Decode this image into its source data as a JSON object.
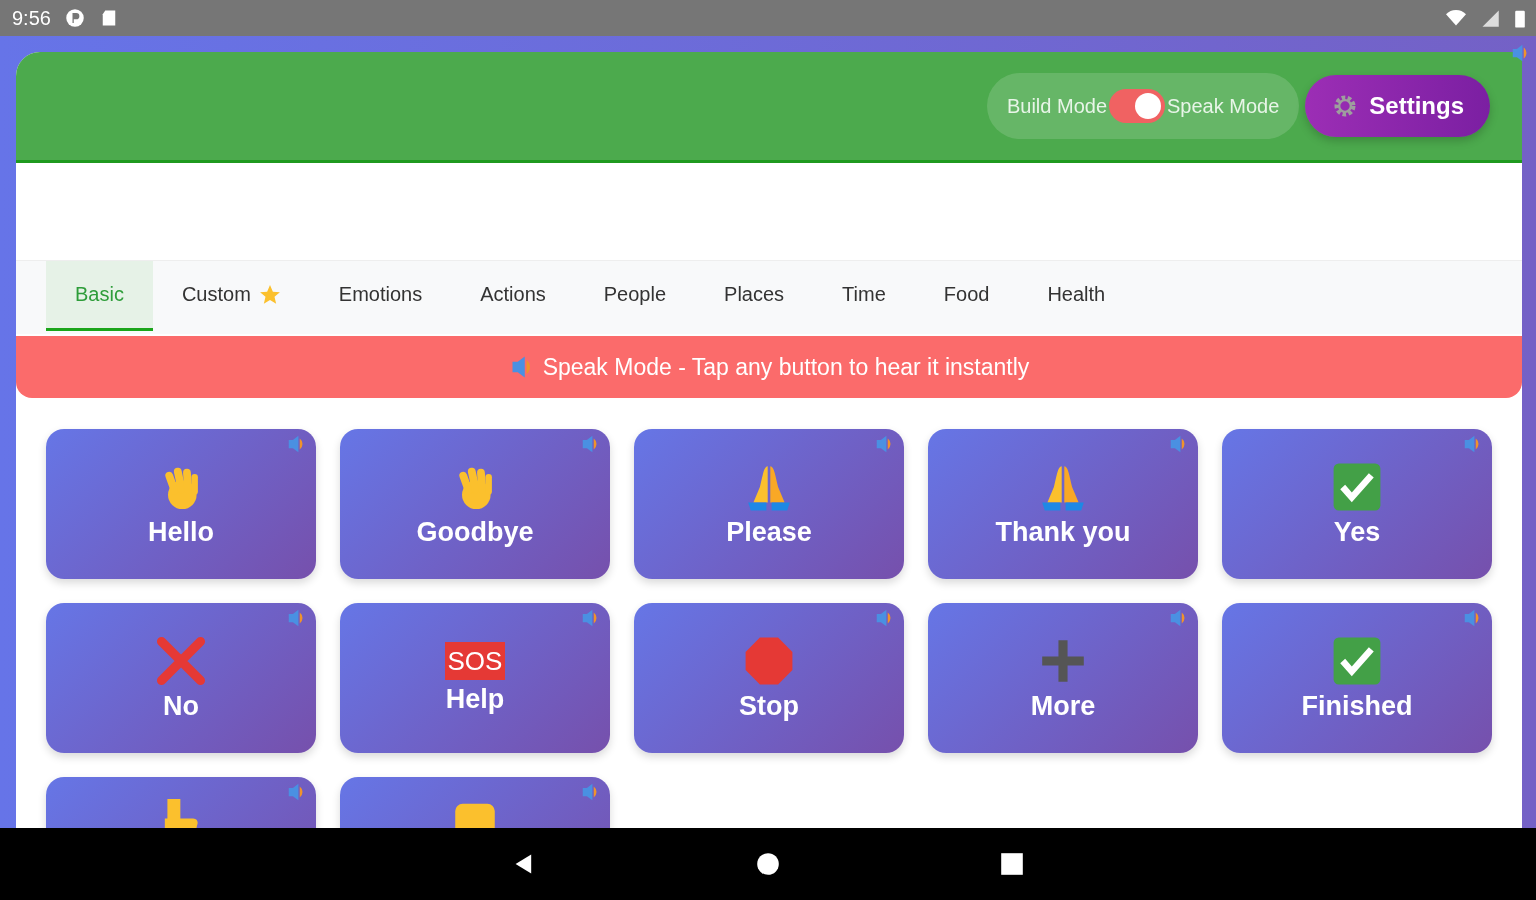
{
  "status_bar": {
    "time": "9:56"
  },
  "header": {
    "mode_toggle": {
      "left_label": "Build Mode",
      "right_label": "Speak Mode",
      "on": true
    },
    "settings_button": "Settings"
  },
  "tabs": [
    {
      "label": "Basic",
      "selected": true
    },
    {
      "label": "Custom",
      "selected": false,
      "starred": true
    },
    {
      "label": "Emotions",
      "selected": false
    },
    {
      "label": "Actions",
      "selected": false
    },
    {
      "label": "People",
      "selected": false
    },
    {
      "label": "Places",
      "selected": false
    },
    {
      "label": "Time",
      "selected": false
    },
    {
      "label": "Food",
      "selected": false
    },
    {
      "label": "Health",
      "selected": false
    }
  ],
  "banner": "Speak Mode - Tap any button to hear it instantly",
  "phrases": [
    {
      "label": "Hello",
      "kind": "wave"
    },
    {
      "label": "Goodbye",
      "kind": "wave"
    },
    {
      "label": "Please",
      "kind": "pray"
    },
    {
      "label": "Thank you",
      "kind": "pray"
    },
    {
      "label": "Yes",
      "kind": "check"
    },
    {
      "label": "No",
      "kind": "cross"
    },
    {
      "label": "Help",
      "kind": "sos",
      "icon_text": "SOS"
    },
    {
      "label": "Stop",
      "kind": "stop"
    },
    {
      "label": "More",
      "kind": "plus"
    },
    {
      "label": "Finished",
      "kind": "check"
    },
    {
      "kind": "thumb"
    },
    {
      "kind": "fist"
    }
  ]
}
